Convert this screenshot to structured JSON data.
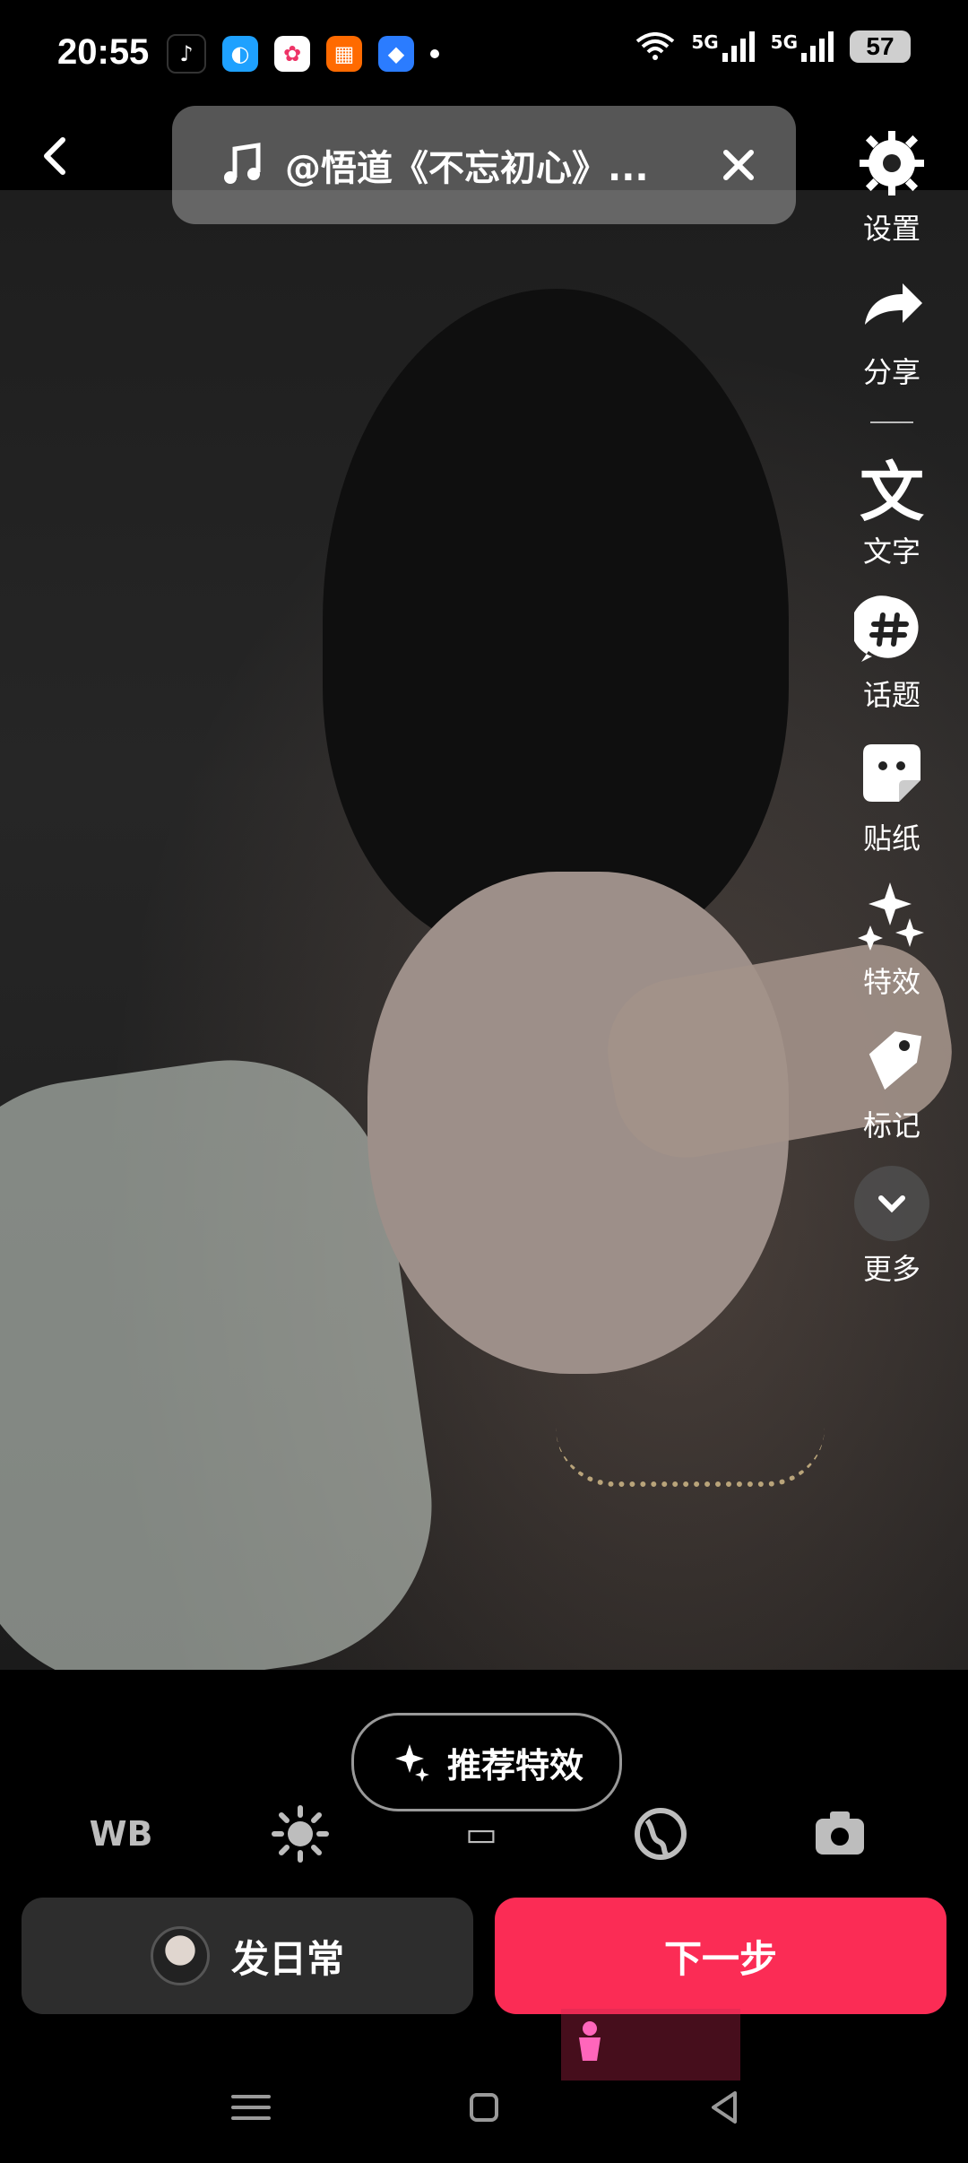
{
  "status_bar": {
    "time": "20:55",
    "battery": "57",
    "network_1": "5G",
    "network_2": "5G"
  },
  "header": {
    "music_title": "@悟道《不忘初心》..."
  },
  "tools": [
    {
      "label": "设置",
      "icon": "gear-icon"
    },
    {
      "label": "分享",
      "icon": "share-icon"
    },
    {
      "label": "文字",
      "icon": "text-icon"
    },
    {
      "label": "话题",
      "icon": "hashtag-icon"
    },
    {
      "label": "贴纸",
      "icon": "sticker-icon"
    },
    {
      "label": "特效",
      "icon": "sparkle-icon"
    },
    {
      "label": "标记",
      "icon": "tag-icon"
    },
    {
      "label": "更多",
      "icon": "chevron-down-icon"
    }
  ],
  "controls": {
    "wb_label": "WB",
    "recommend_label": "推荐特效"
  },
  "bottom_buttons": {
    "left_label": "发日常",
    "right_label": "下一步"
  },
  "colors": {
    "accent": "#fb2c55",
    "dark_button": "#2d2d2d"
  }
}
